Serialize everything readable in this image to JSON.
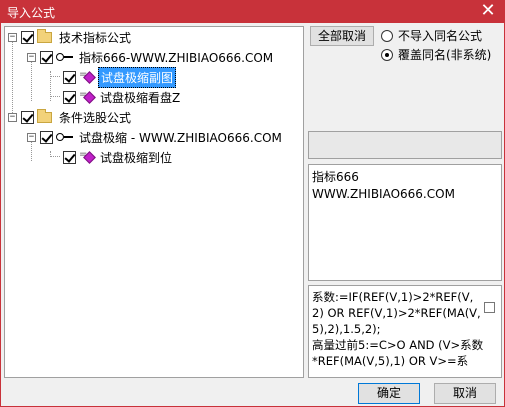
{
  "window": {
    "title": "导入公式",
    "close_glyph": "✕"
  },
  "tree": {
    "nodes": [
      {
        "label": "技术指标公式",
        "type": "folder",
        "expander": "−",
        "checked": true
      },
      {
        "label": "指标666-WWW.ZHIBIAO666.COM",
        "type": "key",
        "expander": "−",
        "checked": true
      },
      {
        "label": "试盘极缩副图",
        "type": "leaf",
        "checked": true,
        "selected": true
      },
      {
        "label": "试盘极缩看盘Z",
        "type": "leaf",
        "checked": true
      },
      {
        "label": "条件选股公式",
        "type": "folder",
        "expander": "−",
        "checked": true
      },
      {
        "label": "试盘极缩 - WWW.ZHIBIAO666.COM",
        "type": "key",
        "expander": "−",
        "checked": true
      },
      {
        "label": "试盘极缩到位",
        "type": "leaf",
        "checked": true
      }
    ]
  },
  "controls": {
    "deselect_all": "全部取消",
    "radio_no_import": "不导入同名公式",
    "radio_overwrite": "覆盖同名(非系统)",
    "selected_radio": "overwrite"
  },
  "description": {
    "line1": "指标666",
    "line2": "WWW.ZHIBIAO666.COM"
  },
  "formula": {
    "text": "系数:=IF(REF(V,1)>2*REF(V,2) OR REF(V,1)>2*REF(MA(V,5),2),1.5,2);\n高量过前5:=C>O AND (V>系数*REF(MA(V,5),1) OR V>=系"
  },
  "footer": {
    "ok": "确定",
    "cancel": "取消"
  }
}
